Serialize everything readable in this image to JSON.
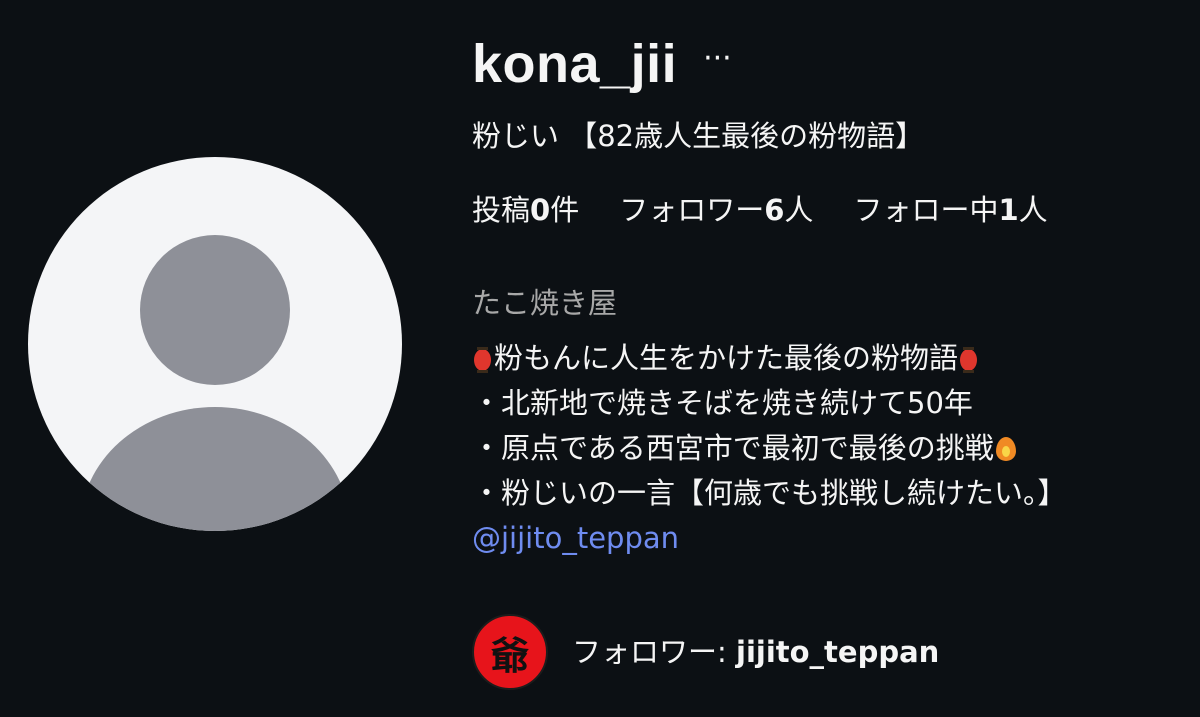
{
  "profile": {
    "username": "kona_jii",
    "more_icon": "ellipsis-icon",
    "full_name": "粉じい 【82歳人生最後の粉物語】"
  },
  "stats": {
    "posts_label": "投稿",
    "posts_count": "0",
    "posts_unit": "件",
    "followers_label": "フォロワー",
    "followers_count": "6",
    "followers_unit": "人",
    "following_label": "フォロー中",
    "following_count": "1",
    "following_unit": "人"
  },
  "category": "たこ焼き屋",
  "bio": {
    "line1": "粉もんに人生をかけた最後の粉物語",
    "line2": "・北新地で焼きそばを焼き続けて50年",
    "line3": "・原点である西宮市で最初で最後の挑戦",
    "line4": "・粉じいの一言【何歳でも挑戦し続けたい。】",
    "emoji_lantern": "red-lantern-icon",
    "emoji_fire": "fire-icon"
  },
  "link": "@jijito_teppan",
  "followed_by": {
    "label": "フォロワー: ",
    "username": "jijito_teppan",
    "avatar_char": "爺"
  },
  "colors": {
    "background": "#0c1014",
    "text": "#f5f5f5",
    "muted": "#a8a8a8",
    "link": "#6f8cf0",
    "avatar_placeholder": "#8e9098",
    "mini_avatar_bg": "#e7141b"
  }
}
